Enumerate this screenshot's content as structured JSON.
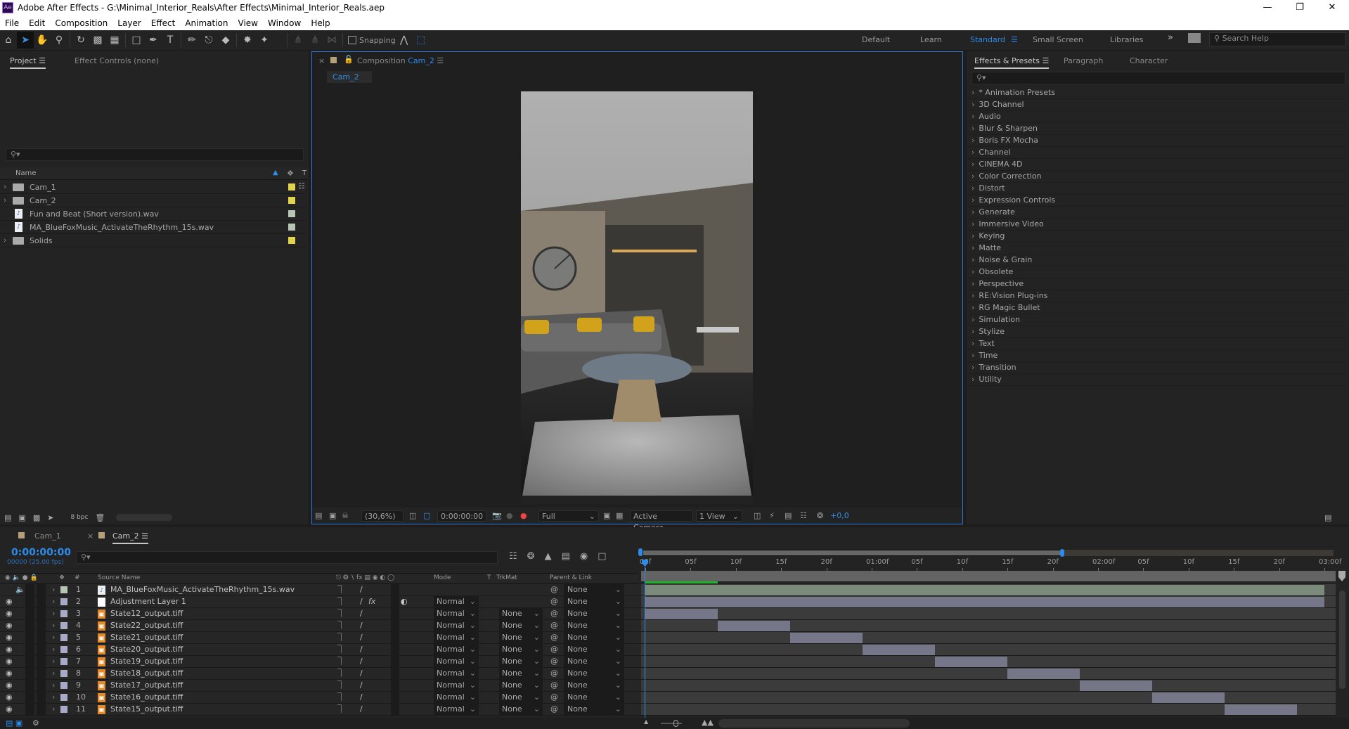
{
  "app": {
    "logo": "Ae",
    "title": "Adobe After Effects - G:\\Minimal_Interior_Reals\\After Effects\\Minimal_Interior_Reals.aep",
    "window_controls": [
      "minimize-icon",
      "restore-icon",
      "close-icon"
    ]
  },
  "menu": [
    "File",
    "Edit",
    "Composition",
    "Layer",
    "Effect",
    "Animation",
    "View",
    "Window",
    "Help"
  ],
  "toolbar": {
    "snapping_label": "Snapping",
    "snapping_checked": false,
    "workspaces": [
      "Default",
      "Learn",
      "Standard",
      "Small Screen",
      "Libraries"
    ],
    "active_workspace": "Standard",
    "search_help": "Search Help"
  },
  "project": {
    "tabs": [
      "Project",
      "Effect Controls (none)"
    ],
    "search_placeholder": "",
    "col_name": "Name",
    "col_type": "T",
    "items": [
      {
        "name": "Cam_1",
        "type": "folder",
        "label": "#e2d44a"
      },
      {
        "name": "Cam_2",
        "type": "folder",
        "label": "#e2d44a"
      },
      {
        "name": "Fun and Beat (Short version).wav",
        "type": "audio",
        "label": "#b5c6b5"
      },
      {
        "name": "MA_BlueFoxMusic_ActivateTheRhythm_15s.wav",
        "type": "audio",
        "label": "#b5c6b5"
      },
      {
        "name": "Solids",
        "type": "folder",
        "label": "#e2d44a"
      }
    ],
    "bpc": "8 bpc"
  },
  "composition": {
    "tab_prefix": "Composition",
    "tab_name": "Cam_2",
    "sub_tab": "Cam_2",
    "zoom": "(30,6%)",
    "timecode": "0:00:00:00",
    "resolution": "Full",
    "camera": "Active Camera",
    "views": "1 View",
    "exposure": "+0,0"
  },
  "effects": {
    "tabs": [
      "Effects & Presets",
      "Paragraph",
      "Character"
    ],
    "items": [
      "* Animation Presets",
      "3D Channel",
      "Audio",
      "Blur & Sharpen",
      "Boris FX Mocha",
      "Channel",
      "CINEMA 4D",
      "Color Correction",
      "Distort",
      "Expression Controls",
      "Generate",
      "Immersive Video",
      "Keying",
      "Matte",
      "Noise & Grain",
      "Obsolete",
      "Perspective",
      "RE:Vision Plug-ins",
      "RG Magic Bullet",
      "Simulation",
      "Stylize",
      "Text",
      "Time",
      "Transition",
      "Utility"
    ]
  },
  "timeline": {
    "tabs": [
      "Cam_1",
      "Cam_2"
    ],
    "active_tab": "Cam_2",
    "timecode": "0:00:00:00",
    "frame_info": "00000 (25.00 fps)",
    "headers": {
      "num": "#",
      "source": "Source Name",
      "mode": "Mode",
      "t": "T",
      "trkmat": "TrkMat",
      "parent": "Parent & Link"
    },
    "ruler": [
      "00f",
      "05f",
      "10f",
      "15f",
      "20f",
      "01:00f",
      "05f",
      "10f",
      "15f",
      "20f",
      "02:00f",
      "05f",
      "10f",
      "15f",
      "20f",
      "03:00f"
    ],
    "fps": 25,
    "duration_frames": 75,
    "layers": [
      {
        "num": "1",
        "name": "MA_BlueFoxMusic_ActivateTheRhythm_15s.wav",
        "type": "audio",
        "label": "#b5c6b5",
        "mode": "",
        "trkmat": "",
        "parent": "None",
        "in": 0,
        "out": 75,
        "bar": "#7c8a7c"
      },
      {
        "num": "2",
        "name": "Adjustment Layer 1",
        "type": "adjust",
        "label": "#a9a9c8",
        "mode": "Normal",
        "trkmat": "",
        "parent": "None",
        "in": 0,
        "out": 75,
        "bar": "#767689"
      },
      {
        "num": "3",
        "name": "State12_output.tiff",
        "type": "image",
        "label": "#a9a9c8",
        "mode": "Normal",
        "trkmat": "None",
        "parent": "None",
        "in": 0,
        "out": 8,
        "bar": "#767689"
      },
      {
        "num": "4",
        "name": "State22_output.tiff",
        "type": "image",
        "label": "#a9a9c8",
        "mode": "Normal",
        "trkmat": "None",
        "parent": "None",
        "in": 8,
        "out": 16,
        "bar": "#767689"
      },
      {
        "num": "5",
        "name": "State21_output.tiff",
        "type": "image",
        "label": "#a9a9c8",
        "mode": "Normal",
        "trkmat": "None",
        "parent": "None",
        "in": 16,
        "out": 24,
        "bar": "#767689"
      },
      {
        "num": "6",
        "name": "State20_output.tiff",
        "type": "image",
        "label": "#a9a9c8",
        "mode": "Normal",
        "trkmat": "None",
        "parent": "None",
        "in": 24,
        "out": 32,
        "bar": "#767689"
      },
      {
        "num": "7",
        "name": "State19_output.tiff",
        "type": "image",
        "label": "#a9a9c8",
        "mode": "Normal",
        "trkmat": "None",
        "parent": "None",
        "in": 32,
        "out": 40,
        "bar": "#767689"
      },
      {
        "num": "8",
        "name": "State18_output.tiff",
        "type": "image",
        "label": "#a9a9c8",
        "mode": "Normal",
        "trkmat": "None",
        "parent": "None",
        "in": 40,
        "out": 48,
        "bar": "#767689"
      },
      {
        "num": "9",
        "name": "State17_output.tiff",
        "type": "image",
        "label": "#a9a9c8",
        "mode": "Normal",
        "trkmat": "None",
        "parent": "None",
        "in": 48,
        "out": 56,
        "bar": "#767689"
      },
      {
        "num": "10",
        "name": "State16_output.tiff",
        "type": "image",
        "label": "#a9a9c8",
        "mode": "Normal",
        "trkmat": "None",
        "parent": "None",
        "in": 56,
        "out": 64,
        "bar": "#767689"
      },
      {
        "num": "11",
        "name": "State15_output.tiff",
        "type": "image",
        "label": "#a9a9c8",
        "mode": "Normal",
        "trkmat": "None",
        "parent": "None",
        "in": 64,
        "out": 72,
        "bar": "#767689"
      }
    ]
  },
  "colors": {
    "accent": "#2d8ceb",
    "panel": "#232323",
    "highlight_border": "#2d7ad6"
  }
}
